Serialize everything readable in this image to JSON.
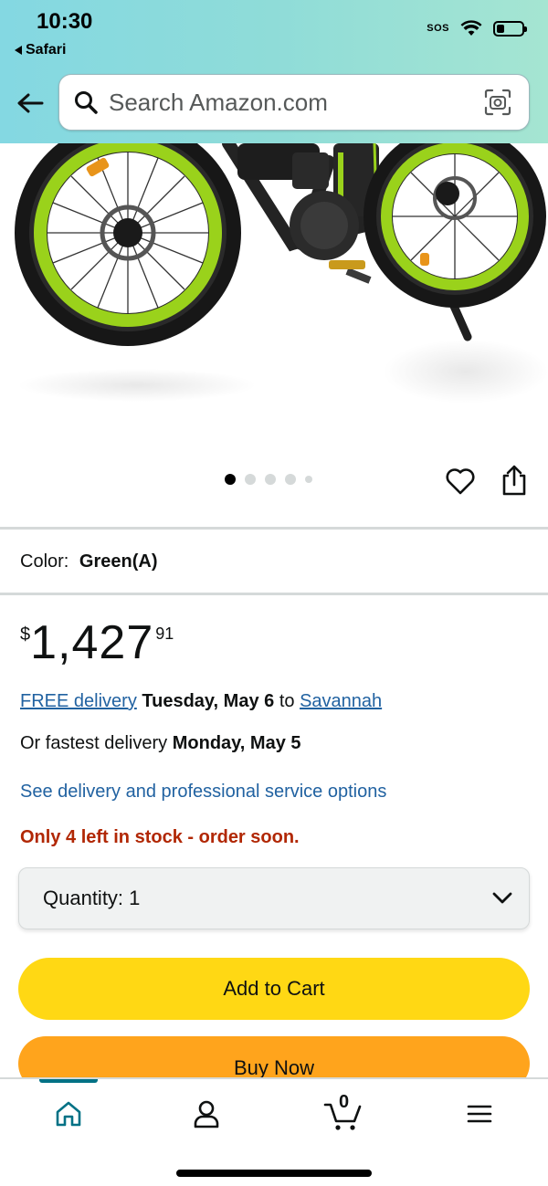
{
  "status_bar": {
    "time": "10:30",
    "back_app": "Safari",
    "sos": "SOS"
  },
  "search": {
    "placeholder": "Search Amazon.com"
  },
  "product": {
    "carousel": {
      "total": 5,
      "active_index": 0
    },
    "color_label": "Color:",
    "color_value": "Green(A)"
  },
  "price": {
    "symbol": "$",
    "whole": "1,427",
    "fraction": "91"
  },
  "delivery": {
    "free_delivery_link": "FREE delivery",
    "date": "Tuesday, May 6",
    "to_text": "to",
    "location_link": "Savannah",
    "fastest_prefix": "Or fastest delivery",
    "fastest_date": "Monday, May 5",
    "options_link": "See delivery and professional service options"
  },
  "stock_message": "Only 4 left in stock - order soon.",
  "quantity": {
    "label": "Quantity:",
    "value": "1"
  },
  "buttons": {
    "add_to_cart": "Add to Cart",
    "buy_now": "Buy Now"
  },
  "bottom_nav": {
    "cart_count": "0",
    "active": "home"
  },
  "colors": {
    "accent_teal": "#007185",
    "link": "#2162a1",
    "stock_red": "#b12704",
    "cart_yellow": "#ffd814",
    "buy_orange": "#ffa41c",
    "bike_green": "#9ad21b"
  }
}
